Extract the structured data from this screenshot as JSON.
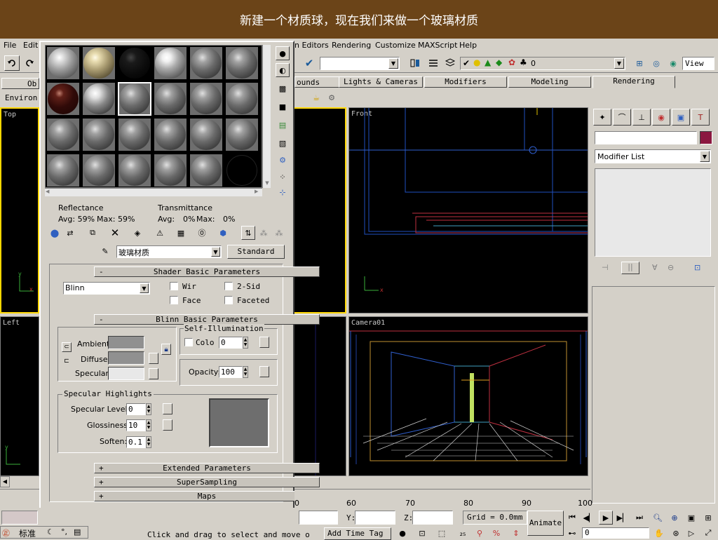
{
  "slide_title": "新建一个材质球，现在我们来做一个玻璃材质",
  "menu": [
    "File",
    "Edit",
    "n Editors",
    "Rendering",
    "Customize",
    "MAXScript",
    "Help"
  ],
  "toolbar": {
    "selection_value": "0",
    "view_label": "View"
  },
  "tabs": [
    "ounds",
    "Lights & Cameras",
    "Modifiers",
    "Modeling",
    "Rendering"
  ],
  "left_panel": {
    "ob_label": "Ob",
    "environ_label": "Environ"
  },
  "viewports": {
    "top": "Top",
    "front": "Front",
    "left": "Left",
    "camera": "Camera01"
  },
  "material_editor": {
    "reflectance_label": "Reflectance",
    "reflectance_avg": "Avg:  59%",
    "reflectance_max": "Max:  59%",
    "transmittance_label": "Transmittance",
    "transmittance_avg": "Avg:",
    "transmittance_avg_val": "0%",
    "transmittance_max": "Max:",
    "transmittance_max_val": "0%",
    "material_name": "玻璃材质",
    "material_type": "Standard",
    "shader_rollout": "Shader Basic Parameters",
    "shader_value": "Blinn",
    "wire_label": "Wir",
    "twosided_label": "2-Sid",
    "face_label": "Face",
    "faceted_label": "Faceted",
    "blinn_rollout": "Blinn Basic Parameters",
    "self_illum_label": "Self-Illumination",
    "color_label": "Colo",
    "color_value": "0",
    "ambient_label": "Ambient:",
    "diffuse_label": "Diffuse:",
    "specular_label": "Specular:",
    "opacity_label": "Opacity:",
    "opacity_value": "100",
    "spec_highlights_label": "Specular Highlights",
    "spec_level_label": "Specular Level:",
    "spec_level_value": "0",
    "glossiness_label": "Glossiness:",
    "glossiness_value": "10",
    "soften_label": "Soften:",
    "soften_value": "0.1",
    "extended_rollout": "Extended Parameters",
    "supersampling_rollout": "SuperSampling",
    "maps_rollout": "Maps",
    "plus": "+",
    "minus": "-",
    "colors": {
      "ambient": "#909090",
      "diffuse": "#909090",
      "specular": "#e8e8e8",
      "highlight_preview": "#6e6e6e"
    }
  },
  "command_panel": {
    "modifier_list": "Modifier List",
    "color_swatch": "#8b1840"
  },
  "timeline": {
    "ticks": [
      "0",
      "60",
      "70",
      "80",
      "90",
      "100"
    ]
  },
  "status": {
    "x_label": "X:",
    "y_label": "Y:",
    "z_label": "Z:",
    "grid_label": "Grid = 0.0mm",
    "add_time_tag": "Add Time Tag",
    "prompt": "Click and drag to select and move o",
    "animate": "Animate",
    "frame_value": "0",
    "ime_label": "标准"
  }
}
